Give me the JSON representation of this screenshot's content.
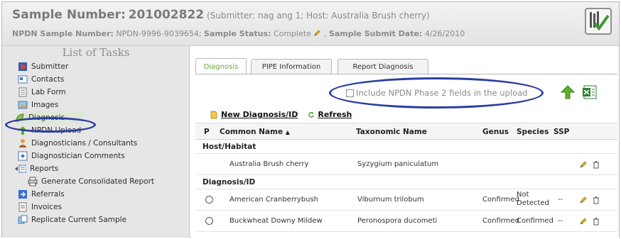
{
  "header": {
    "sample_number_label": "Sample Number:",
    "sample_number": "201002822",
    "submitter_text": "(Submitter: nag ang 1; Host: Australia Brush cherry)",
    "npdn_label": "NPDN Sample Number:",
    "npdn_value": "NPDN-9996-9039654;",
    "status_label": "Sample Status:",
    "status_value": "Complete",
    "submit_date_label": "Sample Submit Date:",
    "submit_date_value": "4/26/2010"
  },
  "sidebar": {
    "title": "List of Tasks",
    "items": [
      {
        "label": "Submitter",
        "icon": "submitter-icon"
      },
      {
        "label": "Contacts",
        "icon": "contacts-icon"
      },
      {
        "label": "Lab Form",
        "icon": "lab-form-icon"
      },
      {
        "label": "Images",
        "icon": "images-icon"
      },
      {
        "label": "Diagnosis",
        "icon": "diagnosis-icon"
      },
      {
        "label": "NPDN Upload",
        "icon": "upload-icon"
      },
      {
        "label": "Diagnosticians / Consultants",
        "icon": "person-icon"
      },
      {
        "label": "Diagnostician Comments",
        "icon": "comments-icon"
      },
      {
        "label": "Reports",
        "icon": "reports-icon"
      },
      {
        "label": "Generate Consolidated Report",
        "icon": "printer-icon"
      },
      {
        "label": "Referrals",
        "icon": "referrals-icon"
      },
      {
        "label": "Invoices",
        "icon": "invoices-icon"
      },
      {
        "label": "Replicate Current Sample",
        "icon": "replicate-icon"
      }
    ]
  },
  "tabs": [
    {
      "label": "Diagnosis"
    },
    {
      "label": "PIPE Information"
    },
    {
      "label": "Report Diagnosis"
    }
  ],
  "upload_option": {
    "label": "Include NPDN Phase 2 fields in the upload"
  },
  "actions": {
    "new_label": "New Diagnosis/ID",
    "refresh_label": "Refresh"
  },
  "grid": {
    "columns": [
      "P",
      "Common Name",
      "Taxonomic Name",
      "Genus",
      "Species",
      "SSP"
    ],
    "sort_glyph": "▲",
    "host_section": "Host/Habitat",
    "host_row": {
      "common_name": "Australia Brush cherry",
      "taxonomic_name": "Syzygium paniculatum"
    },
    "diag_section": "Diagnosis/ID",
    "diag_rows": [
      {
        "common_name": "American Cranberrybush",
        "taxonomic_name": "Viburnum trilobum",
        "genus": "Confirmed",
        "species_line1": "Not",
        "species_line2": "Detected",
        "ssp": "--"
      },
      {
        "common_name": "Buckwheat Downy Mildew",
        "taxonomic_name": "Peronospora ducometi",
        "genus": "Confirmed",
        "species_line1": "Confirmed",
        "species_line2": "",
        "ssp": "--"
      }
    ]
  },
  "colors": {
    "annotation_oval": "#2b3fa1",
    "active_tab": "#6aa83c",
    "upload_arrow": "#5fae2d"
  }
}
